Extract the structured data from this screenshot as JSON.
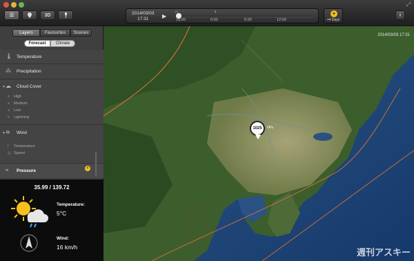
{
  "toolbar": {
    "date": "2014/03/03",
    "time": "17:31",
    "play_icon": "play-icon",
    "ticks": [
      "18:00",
      "0:00",
      "6:00",
      "12:00"
    ],
    "forecast_days_label": "+4 Days",
    "view_2d_label": "☰",
    "location_icon": "location-icon",
    "view_3d_label": "3D",
    "pin_icon": "pin-icon",
    "info_label": "i"
  },
  "sidebar": {
    "tabs": [
      {
        "label": "Layers"
      },
      {
        "label": "Favourites"
      },
      {
        "label": "Scenes"
      }
    ],
    "subtabs": [
      {
        "label": "Forecast"
      },
      {
        "label": "Climate"
      }
    ],
    "layers": {
      "temperature": "Temperature",
      "precipitation": "Precipitation",
      "cloud_cover": "Cloud Cover",
      "cloud_items": [
        "High",
        "Medium",
        "Low",
        "Lightning"
      ],
      "wind": "Wind",
      "wind_items": [
        "Temperature",
        "Speed"
      ],
      "pressure": "Pressure"
    }
  },
  "weather": {
    "coords": "35.99 / 139.72",
    "temperature_label": "Temperature:",
    "temperature_value": "5°C",
    "wind_label": "Wind:",
    "wind_value": "16 km/h"
  },
  "map": {
    "datetime": "2014/03/03  17:31",
    "pressure_value": "1025",
    "pressure_unit": "hPa",
    "watermark": "週刊アスキー"
  },
  "colors": {
    "accent": "#f0c020",
    "route": "#c8703a"
  }
}
